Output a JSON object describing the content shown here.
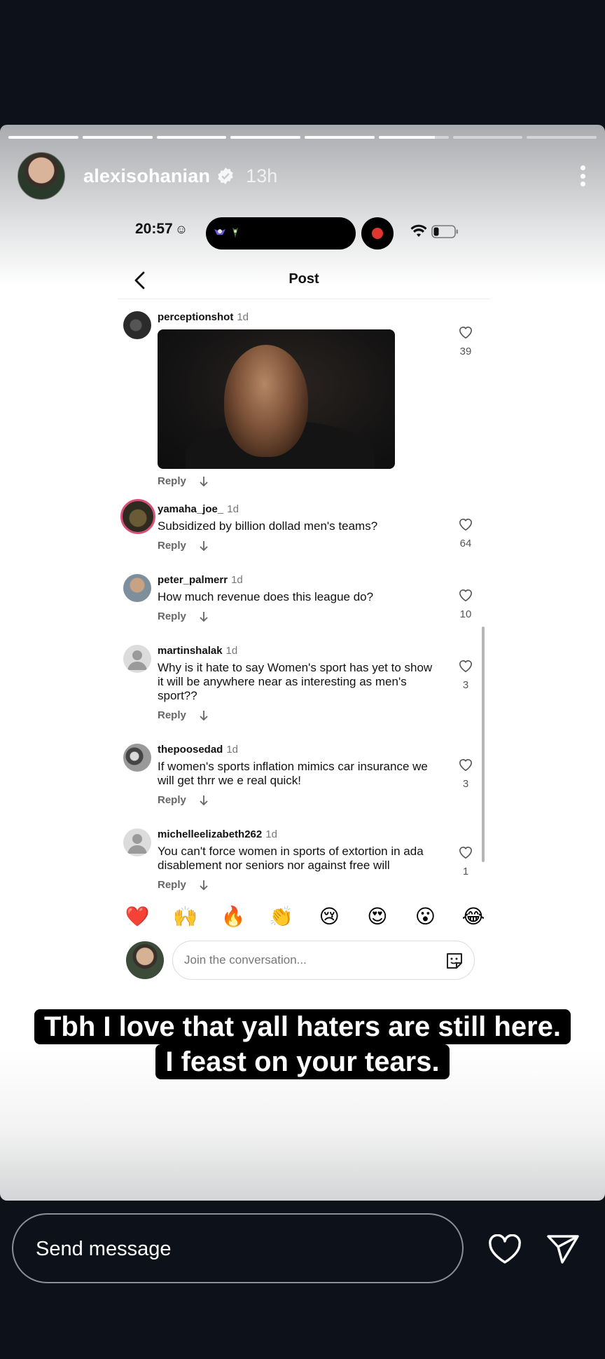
{
  "story": {
    "username": "alexisohanian",
    "time": "13h",
    "progress": [
      1,
      1,
      1,
      1,
      1,
      0.8,
      0,
      0
    ]
  },
  "status": {
    "time": "20:57",
    "smile": "☺"
  },
  "post": {
    "title": "Post"
  },
  "comments": [
    {
      "user": "perceptionshot",
      "time": "1d",
      "text": "",
      "likes": "39",
      "reply": "Reply"
    },
    {
      "user": "yamaha_joe_",
      "time": "1d",
      "text": "Subsidized by billion dollad men's teams?",
      "likes": "64",
      "reply": "Reply"
    },
    {
      "user": "peter_palmerr",
      "time": "1d",
      "text": "How much revenue does this league do?",
      "likes": "10",
      "reply": "Reply"
    },
    {
      "user": "martinshalak",
      "time": "1d",
      "text": "Why is it hate to say Women's sport has yet to show it will be anywhere near as interesting as men's sport??",
      "likes": "3",
      "reply": "Reply"
    },
    {
      "user": "thepoosedad",
      "time": "1d",
      "text": "If women's sports inflation mimics car insurance we will get thrr we e real quick!",
      "likes": "3",
      "reply": "Reply"
    },
    {
      "user": "michelleelizabeth262",
      "time": "1d",
      "text": "You can't force women in sports of extortion in ada disablement nor seniors nor against free will",
      "likes": "1",
      "reply": "Reply"
    }
  ],
  "reactions": [
    "❤️",
    "🙌",
    "🔥",
    "👏",
    "😢",
    "😍",
    "😮",
    "😂"
  ],
  "composer": {
    "placeholder": "Join the conversation..."
  },
  "caption": {
    "line1": "Tbh I love that yall haters are still here.",
    "line2": "I feast on your tears."
  },
  "bottom": {
    "send_placeholder": "Send message"
  },
  "colors": {
    "background": "#0d121a",
    "record": "#e0382f"
  }
}
